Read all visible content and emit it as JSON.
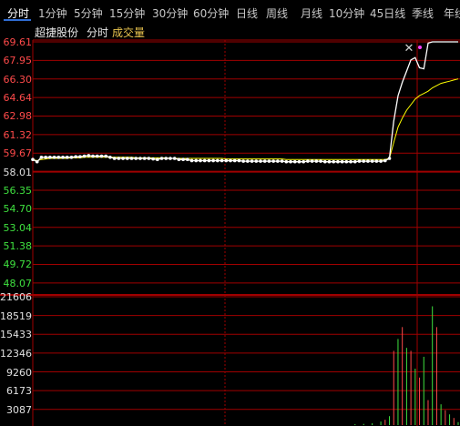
{
  "tabs": [
    {
      "label": "分时",
      "active": true
    },
    {
      "label": "1分钟"
    },
    {
      "label": "5分钟"
    },
    {
      "label": "15分钟"
    },
    {
      "label": "30分钟"
    },
    {
      "label": "60分钟"
    },
    {
      "label": "日线"
    },
    {
      "label": "周线"
    },
    {
      "label": "月线"
    },
    {
      "label": "10分钟"
    },
    {
      "label": "45日线"
    },
    {
      "label": "季线"
    },
    {
      "label": "年线"
    }
  ],
  "info": {
    "stock_name": "超捷股份",
    "mode": "分时",
    "volume_label": "成交量"
  },
  "price_axis": {
    "labels": [
      "69.61",
      "67.95",
      "66.30",
      "64.64",
      "62.98",
      "61.32",
      "59.67",
      "58.01",
      "56.35",
      "54.70",
      "53.04",
      "51.38",
      "49.72",
      "48.07"
    ],
    "colors": {
      "up": "#ff4a4a",
      "base": "#e0e0e0",
      "down": "#3fe13f"
    }
  },
  "volume_axis": {
    "labels": [
      "21606",
      "18519",
      "15433",
      "12346",
      "9260",
      "6173",
      "3087"
    ]
  },
  "icons": {
    "close": "close-icon",
    "marker": "marker-dot-icon"
  },
  "colors": {
    "grid": "#a00000",
    "price_line": "#ffffff",
    "avg_line": "#ffff00",
    "bg": "#000000"
  },
  "chart_data": {
    "type": "line",
    "ylim": [
      48.07,
      69.61
    ],
    "series": [
      {
        "values": [
          59.1,
          58.9,
          59.3,
          59.3,
          59.3,
          59.3,
          59.3,
          59.3,
          59.3,
          59.3,
          59.35,
          59.35,
          59.4,
          59.45,
          59.4,
          59.4,
          59.4,
          59.4,
          59.3,
          59.2,
          59.2,
          59.2,
          59.2,
          59.2,
          59.2,
          59.2,
          59.2,
          59.2,
          59.15,
          59.1,
          59.2,
          59.2,
          59.2,
          59.2,
          59.1,
          59.1,
          59.1,
          59.0,
          59.0,
          59.0,
          59.0,
          59.0,
          59.0,
          59.0,
          59.0,
          59.0,
          59.0,
          59.0,
          59.0,
          58.95,
          58.95,
          58.95,
          58.95,
          58.95,
          58.95,
          58.95,
          58.95,
          58.95,
          58.95,
          58.9,
          58.9,
          58.9,
          58.9,
          58.9,
          58.95,
          58.95,
          58.95,
          58.95,
          58.9,
          58.9,
          58.9,
          58.9,
          58.9,
          58.9,
          58.9,
          58.9,
          58.95,
          58.95,
          58.95,
          58.95,
          58.95,
          58.95,
          59.0,
          59.2,
          62.5,
          64.8,
          66.0,
          67.0,
          68.0,
          68.2,
          67.3,
          67.2,
          69.5,
          69.61,
          69.61,
          69.61,
          69.61,
          69.61,
          69.61,
          69.61
        ]
      },
      {
        "values": [
          59.1,
          59.0,
          59.1,
          59.15,
          59.2,
          59.2,
          59.2,
          59.2,
          59.2,
          59.25,
          59.25,
          59.25,
          59.3,
          59.3,
          59.3,
          59.3,
          59.3,
          59.3,
          59.3,
          59.3,
          59.3,
          59.3,
          59.3,
          59.3,
          59.25,
          59.25,
          59.25,
          59.25,
          59.25,
          59.25,
          59.25,
          59.25,
          59.2,
          59.2,
          59.2,
          59.2,
          59.2,
          59.2,
          59.2,
          59.2,
          59.2,
          59.2,
          59.2,
          59.2,
          59.2,
          59.15,
          59.15,
          59.15,
          59.15,
          59.15,
          59.15,
          59.15,
          59.15,
          59.15,
          59.15,
          59.15,
          59.15,
          59.15,
          59.15,
          59.1,
          59.1,
          59.1,
          59.1,
          59.1,
          59.1,
          59.1,
          59.1,
          59.1,
          59.1,
          59.1,
          59.1,
          59.1,
          59.1,
          59.1,
          59.1,
          59.1,
          59.1,
          59.1,
          59.1,
          59.1,
          59.1,
          59.1,
          59.1,
          59.2,
          60.6,
          62.0,
          62.8,
          63.5,
          64.0,
          64.5,
          64.8,
          65.0,
          65.2,
          65.5,
          65.7,
          65.9,
          66.0,
          66.1,
          66.2,
          66.3
        ]
      }
    ],
    "volume": [
      0,
      0,
      0,
      0,
      0,
      0,
      0,
      0,
      0,
      0,
      0,
      0,
      0,
      0,
      0,
      0,
      0,
      0,
      0,
      0,
      0,
      0,
      0,
      0,
      0,
      0,
      0,
      0,
      0,
      0,
      0,
      0,
      0,
      0,
      0,
      0,
      0,
      0,
      0,
      0,
      0,
      0,
      0,
      0,
      0,
      0,
      0,
      0,
      0,
      0,
      0,
      0,
      0,
      0,
      0,
      0,
      0,
      0,
      0,
      0,
      0,
      0,
      0,
      0,
      0,
      0,
      0,
      0,
      0,
      0,
      0,
      0,
      0,
      0,
      0,
      150,
      0,
      200,
      0,
      300,
      0,
      600,
      900,
      1500,
      12500,
      14500,
      16500,
      13000,
      12500,
      9500,
      8000,
      11500,
      4200,
      20000,
      16500,
      3500,
      2500,
      1800,
      1200,
      500
    ]
  }
}
